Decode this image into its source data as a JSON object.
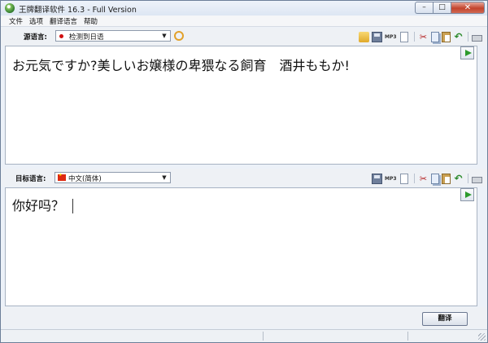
{
  "window": {
    "title": "王牌翻译软件 16.3 - Full Version",
    "controls": {
      "minimize": "–",
      "maximize": "□",
      "close": "✕"
    }
  },
  "menu": [
    "文件",
    "选项",
    "翻译语言",
    "帮助"
  ],
  "source": {
    "label": "源语言:",
    "language": "检测到日语",
    "text": "お元気ですか?美しいお嬢様の卑猥なる飼育　酒井ももか!"
  },
  "target": {
    "label": "目标语言:",
    "language": "中文(简体)",
    "text": "你好吗？"
  },
  "toolbar_icons": {
    "mp3": "MP3",
    "source": [
      "folder-icon",
      "save-icon",
      "mp3-icon",
      "document-icon",
      "cut-icon",
      "copy-icon",
      "paste-icon",
      "undo-icon",
      "print-icon"
    ],
    "target": [
      "save-icon",
      "mp3-icon",
      "document-icon",
      "cut-icon",
      "copy-icon",
      "paste-icon",
      "undo-icon",
      "print-icon"
    ]
  },
  "translate_button": "翻译",
  "colors": {
    "play": "#2c9a2c",
    "close": "#c3432c",
    "flag": "#de2910"
  }
}
